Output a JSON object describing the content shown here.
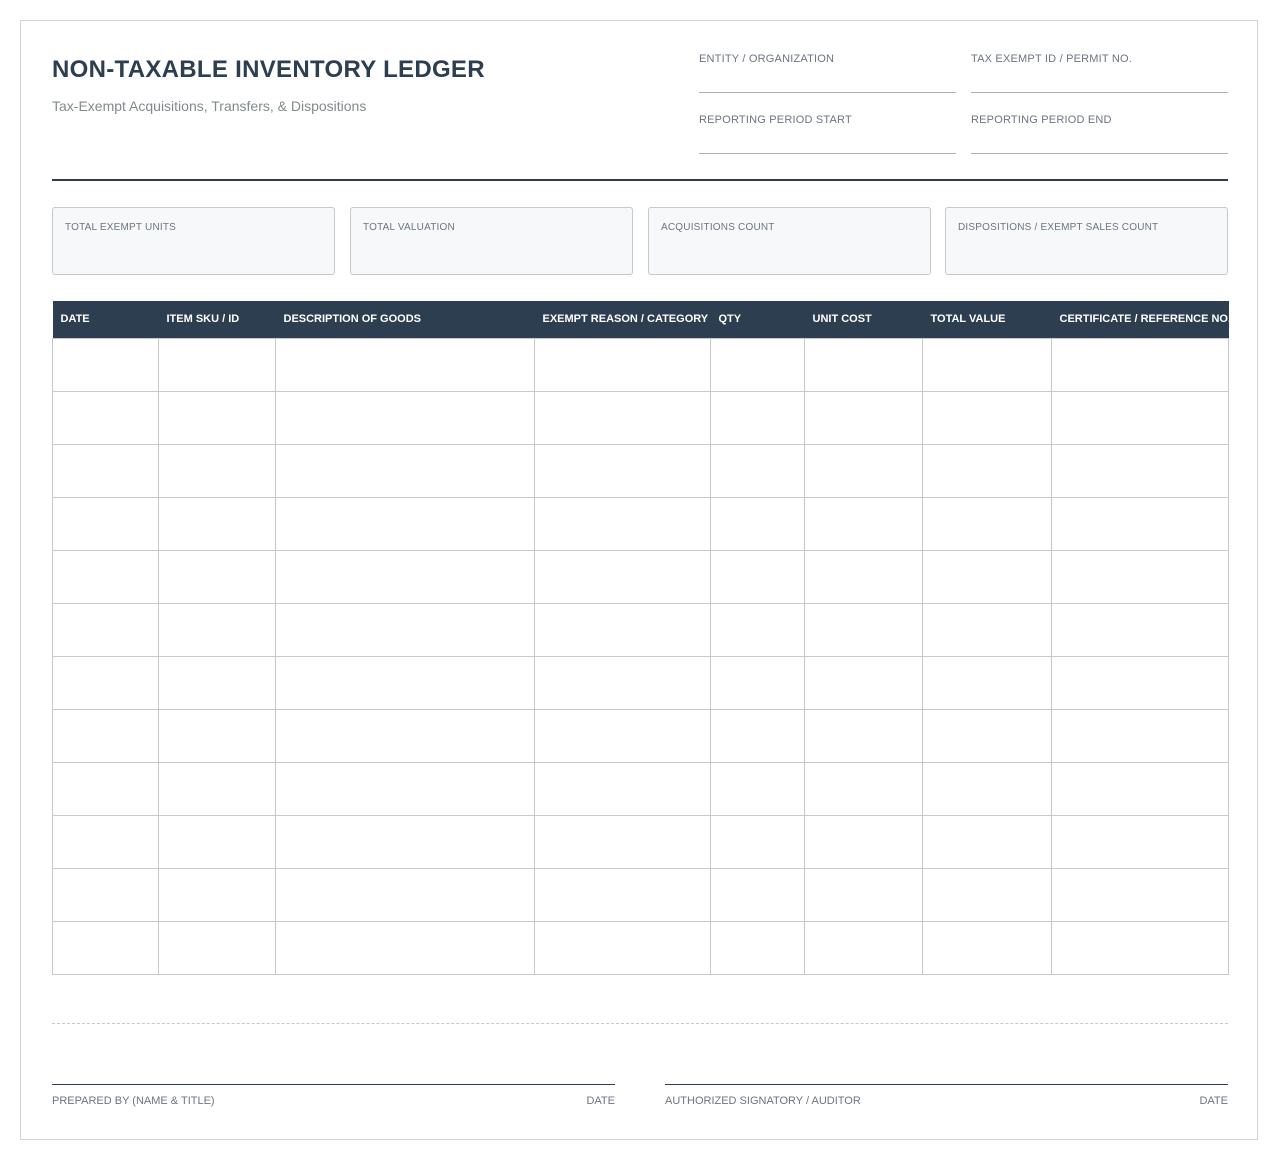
{
  "header": {
    "title": "NON-TAXABLE INVENTORY LEDGER",
    "subtitle": "Tax-Exempt Acquisitions, Transfers, & Dispositions",
    "fields": {
      "entity": "ENTITY / ORGANIZATION",
      "tax_id": "TAX EXEMPT ID / PERMIT NO.",
      "period_start": "REPORTING PERIOD START",
      "period_end": "REPORTING PERIOD END"
    }
  },
  "summary": {
    "units": "TOTAL EXEMPT UNITS",
    "valuation": "TOTAL VALUATION",
    "acquisitions": "ACQUISITIONS COUNT",
    "dispositions": "DISPOSITIONS / EXEMPT SALES COUNT"
  },
  "table": {
    "columns": [
      "DATE",
      "ITEM SKU / ID",
      "DESCRIPTION OF GOODS",
      "EXEMPT REASON / CATEGORY",
      "QTY",
      "UNIT COST",
      "TOTAL VALUE",
      "CERTIFICATE / REFERENCE NO."
    ],
    "rows": [
      [
        "",
        "",
        "",
        "",
        "",
        "",
        "",
        ""
      ],
      [
        "",
        "",
        "",
        "",
        "",
        "",
        "",
        ""
      ],
      [
        "",
        "",
        "",
        "",
        "",
        "",
        "",
        ""
      ],
      [
        "",
        "",
        "",
        "",
        "",
        "",
        "",
        ""
      ],
      [
        "",
        "",
        "",
        "",
        "",
        "",
        "",
        ""
      ],
      [
        "",
        "",
        "",
        "",
        "",
        "",
        "",
        ""
      ],
      [
        "",
        "",
        "",
        "",
        "",
        "",
        "",
        ""
      ],
      [
        "",
        "",
        "",
        "",
        "",
        "",
        "",
        ""
      ],
      [
        "",
        "",
        "",
        "",
        "",
        "",
        "",
        ""
      ],
      [
        "",
        "",
        "",
        "",
        "",
        "",
        "",
        ""
      ],
      [
        "",
        "",
        "",
        "",
        "",
        "",
        "",
        ""
      ],
      [
        "",
        "",
        "",
        "",
        "",
        "",
        "",
        ""
      ]
    ]
  },
  "footer": {
    "prepared_by": "PREPARED BY (NAME & TITLE)",
    "prepared_date": "DATE",
    "authorized": "AUTHORIZED SIGNATORY / AUDITOR",
    "authorized_date": "DATE"
  }
}
